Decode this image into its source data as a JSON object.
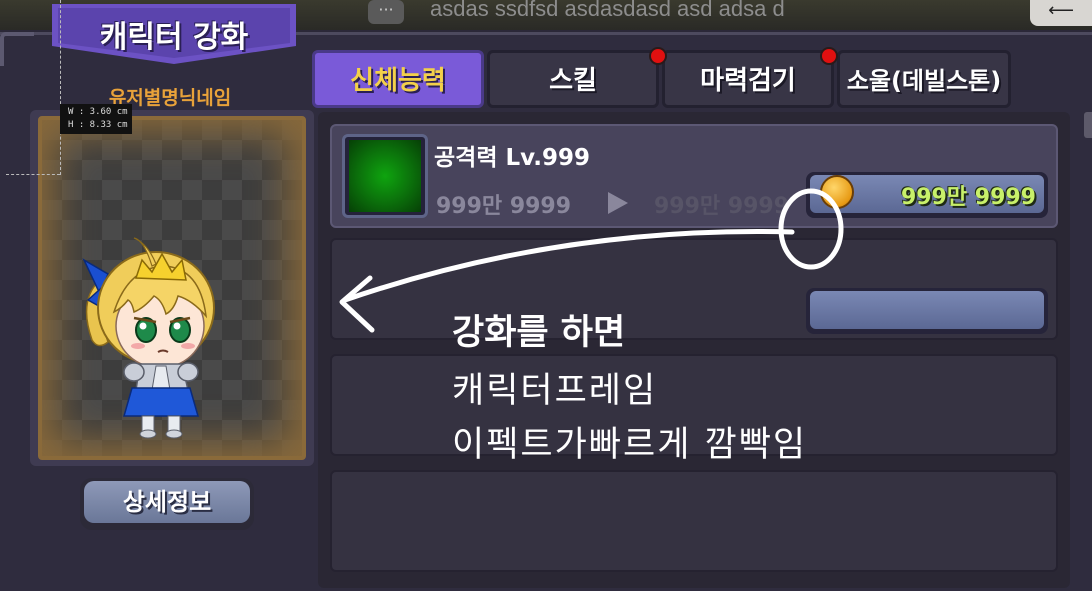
{
  "chat": {
    "icon": "chat-bubble-icon",
    "message": "asdas ssdfsd asdasdasd asd adsa d"
  },
  "header": {
    "title": "캐릭터 강화",
    "back_icon": "back-arrow-icon"
  },
  "character": {
    "nickname": "유저별명닉네임",
    "measure_w": "W :  3.60 cm",
    "measure_h": "H :  8.33 cm",
    "detail_button": "상세정보"
  },
  "tabs": [
    {
      "label": "신체능력",
      "active": true,
      "badge": false
    },
    {
      "label": "스킬",
      "active": false,
      "badge": true
    },
    {
      "label": "마력검기",
      "active": false,
      "badge": true
    },
    {
      "label": "소울(데빌스톤)",
      "active": false,
      "badge": false
    }
  ],
  "stat_rows": [
    {
      "name": "공격력 Lv.999",
      "current_value": "999만 9999",
      "next_value": "999만 9999",
      "cost": "999만 9999",
      "cost_icon": "gold-coin-icon"
    }
  ],
  "annotation": {
    "line1": "강화를 하면",
    "line2": "캐릭터프레임",
    "line3": "이펙트가빠르게 깜빡임"
  },
  "colors": {
    "accent": "#7a5ad8",
    "tab_active_text": "#f3d04a",
    "nickname": "#e8a23a",
    "cost_text": "#c8f06a",
    "badge": "#e01010",
    "frame_border": "#8a6a3a"
  }
}
